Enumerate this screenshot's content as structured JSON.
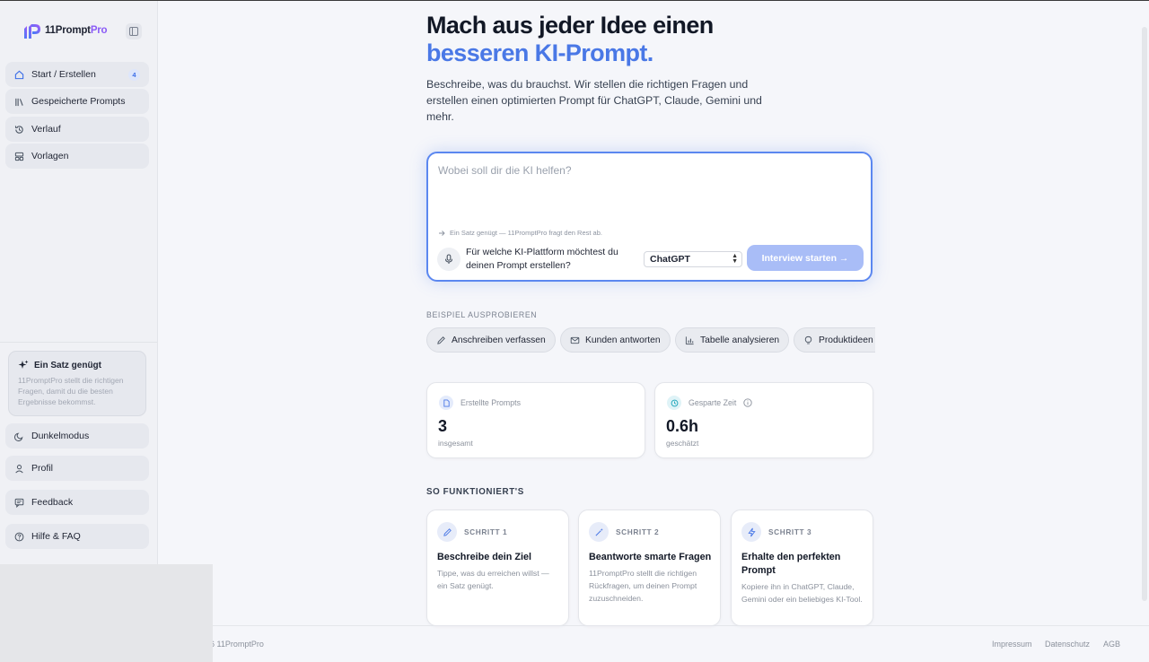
{
  "app": {
    "logo_prefix": "11Prompt",
    "logo_suffix": "Pro",
    "brand_color": "#4a78e6"
  },
  "sidebar": {
    "items": [
      {
        "label": "Start / Erstellen",
        "icon": "home-icon",
        "badge": "4"
      },
      {
        "label": "Gespeicherte Prompts",
        "icon": "library-icon"
      },
      {
        "label": "Verlauf",
        "icon": "history-icon"
      },
      {
        "label": "Vorlagen",
        "icon": "templates-icon"
      }
    ],
    "tip": {
      "title": "Ein Satz genügt",
      "text": "11PromptPro stellt die richtigen Fragen, damit du die besten Ergebnisse bekommst."
    },
    "bottom_items": [
      {
        "label": "Dunkelmodus",
        "icon": "moon-icon"
      },
      {
        "label": "Profil",
        "icon": "user-icon"
      },
      {
        "label": "Feedback",
        "icon": "feedback-icon"
      },
      {
        "label": "Hilfe & FAQ",
        "icon": "help-icon"
      }
    ]
  },
  "hero": {
    "title_line1": "Mach aus jeder Idee einen",
    "title_line2": "besseren KI-Prompt.",
    "subtitle": "Beschreibe, was du brauchst. Wir stellen die richtigen Fragen und erstellen einen optimierten Prompt für ChatGPT, Claude, Gemini und mehr."
  },
  "prompt": {
    "placeholder": "Wobei soll dir die KI helfen?",
    "hint": "Ein Satz genügt — 11PromptPro fragt den Rest ab.",
    "platform_question": "Für welche KI-Plattform möchtest du deinen Prompt erstellen?",
    "platform_selected": "ChatGPT",
    "start_label": "Interview starten →"
  },
  "examples": {
    "label": "BEISPIEL AUSPROBIEREN",
    "chips": [
      {
        "label": "Anschreiben verfassen",
        "icon": "pencil-icon"
      },
      {
        "label": "Kunden antworten",
        "icon": "mail-icon"
      },
      {
        "label": "Tabelle analysieren",
        "icon": "bar-chart-icon"
      },
      {
        "label": "Produktideen s",
        "icon": "lightbulb-icon"
      }
    ]
  },
  "stats": [
    {
      "label": "Erstellte Prompts",
      "value": "3",
      "caption": "insgesamt",
      "icon": "document-icon"
    },
    {
      "label": "Gesparte Zeit",
      "value": "0.6h",
      "caption": "geschätzt",
      "icon": "clock-icon"
    }
  ],
  "how": {
    "label": "SO FUNKTIONIERT'S",
    "steps": [
      {
        "step": "SCHRITT 1",
        "title": "Beschreibe dein Ziel",
        "text": "Tippe, was du erreichen willst — ein Satz genügt.",
        "icon": "pencil-icon"
      },
      {
        "step": "SCHRITT 2",
        "title": "Beantworte smarte Fragen",
        "text": "11PromptPro stellt die richtigen Rückfragen, um deinen Prompt zuzuschneiden.",
        "icon": "magic-wand-icon"
      },
      {
        "step": "SCHRITT 3",
        "title": "Erhalte den perfekten Prompt",
        "text": "Kopiere ihn in ChatGPT, Claude, Gemini oder ein beliebiges KI-Tool.",
        "icon": "lightning-icon"
      }
    ]
  },
  "footer": {
    "copyright": "6 11PromptPro",
    "links": [
      "Impressum",
      "Datenschutz",
      "AGB"
    ]
  }
}
